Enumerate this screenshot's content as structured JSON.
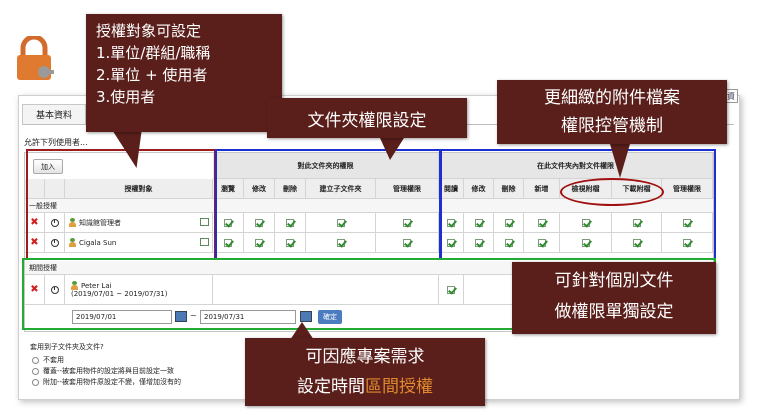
{
  "tab": {
    "label": "基本資料",
    "corner_btn": "資"
  },
  "allow_label": "允許下列使用者...",
  "grid": {
    "add_label": "加入",
    "group_folder": "對此文件夾的權限",
    "group_docs": "在此文件夾內對文件權限",
    "col_target": "授權對象",
    "folder_cols": [
      "瀏覽",
      "修改",
      "刪除",
      "建立子文件夾",
      "管理權限"
    ],
    "doc_cols": [
      "閱讀",
      "修改",
      "刪除",
      "新增",
      "檢視附檔",
      "下載附檔",
      "管理權限"
    ],
    "section_general": "一般授權",
    "section_period": "期間授權",
    "users": [
      "知識館管理者",
      "Cigala Sun"
    ],
    "period_user": "Peter Lai",
    "period_range": "(2019/07/01 ~ 2019/07/31)",
    "date_from": "2019/07/01",
    "date_to": "2019/07/31",
    "tilde": "~",
    "confirm": "確定"
  },
  "apply": {
    "question": "套用到子文件夾及文件?",
    "options": [
      "不套用",
      "覆蓋--被套用物件的設定將與目前設定一致",
      "附加--被套用物件原設定不變，僅增加沒有的"
    ]
  },
  "callouts": {
    "c1": [
      "授權對象可設定",
      "1.單位/群組/職稱",
      "2.單位 + 使用者",
      "3.使用者"
    ],
    "c2": "文件夾權限設定",
    "c3": [
      "更細緻的附件檔案",
      "權限控管機制"
    ],
    "c4": [
      "可針對個別文件",
      "做權限單獨設定"
    ],
    "c5_line1": "可因應專案需求",
    "c5_line2_a": "設定時間",
    "c5_line2_b": "區間授權"
  },
  "colors": {
    "callout": "#5a1f1a",
    "red_box": "#9b1c1c",
    "blue_box": "#1c2fd0",
    "green_box": "#22aa33",
    "accent": "#e0892f"
  }
}
